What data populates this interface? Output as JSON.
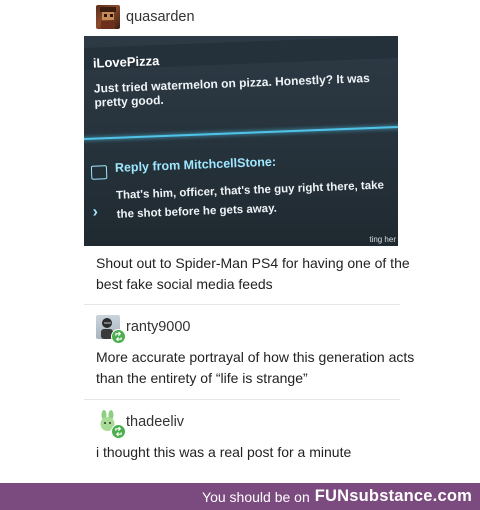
{
  "op": {
    "username": "quasarden",
    "screenshot": {
      "author": "iLovePizza",
      "message": "Just tried watermelon on pizza. Honestly? It was pretty good.",
      "reply_header": "Reply from MitchcellStone:",
      "reply_body": "That's him, officer, that's the guy right there, take the shot before he gets away.",
      "corner_fragment": "ting her"
    },
    "caption": "Shout out to Spider-Man PS4 for having one of the best fake social media feeds"
  },
  "reblogs": [
    {
      "username": "ranty9000",
      "text": "More accurate portrayal of how this generation acts than the entirety of “life is strange”"
    },
    {
      "username": "thadeeliv",
      "text": "i thought this was a real post for a minute"
    }
  ],
  "footer": {
    "prefix": "You should be on",
    "brand": "FUNsubstance.com"
  }
}
